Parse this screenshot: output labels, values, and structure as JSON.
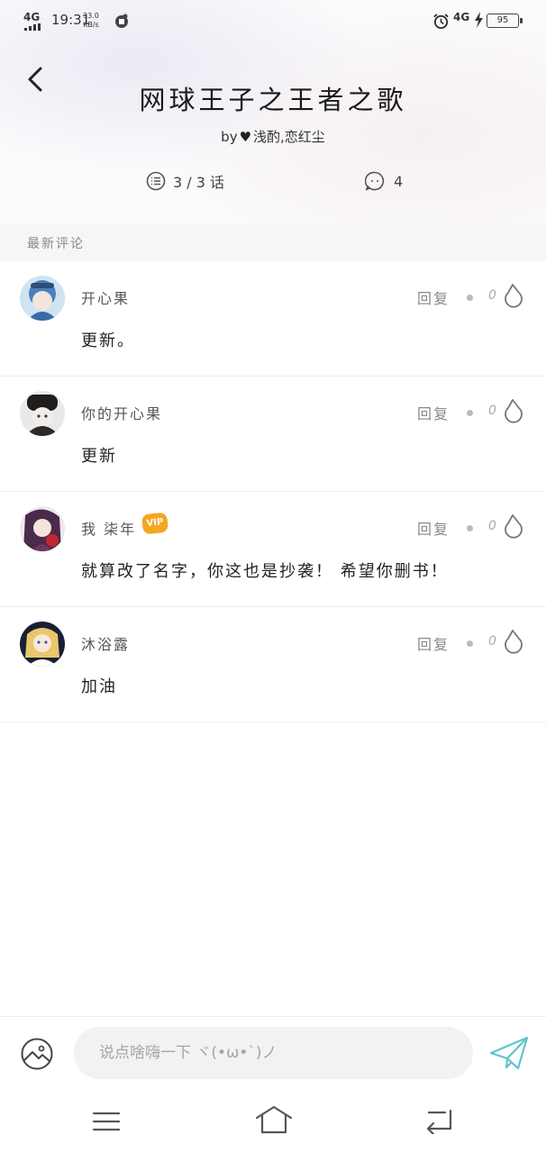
{
  "status_bar": {
    "signal_label": "4G",
    "time": "19:31",
    "speed_value": "33.0",
    "speed_unit": "KB/s",
    "network_label": "4G",
    "battery_level": "95"
  },
  "book": {
    "title": "网球王子之王者之歌",
    "author_prefix": "by",
    "author_name": "浅酌,恋红尘",
    "chapters": "3 / 3 话",
    "comment_count": "4"
  },
  "section": {
    "title": "最新评论"
  },
  "comments": [
    {
      "username": "开心果",
      "vip": false,
      "reply_label": "回复",
      "likes": "0",
      "text": "更新。"
    },
    {
      "username": "你的开心果",
      "vip": false,
      "reply_label": "回复",
      "likes": "0",
      "text": "更新"
    },
    {
      "username": "我 柒年",
      "vip": true,
      "vip_label": "VIP",
      "reply_label": "回复",
      "likes": "0",
      "text": "就算改了名字，你这也是抄袭！ 希望你删书！"
    },
    {
      "username": "沐浴露",
      "vip": false,
      "reply_label": "回复",
      "likes": "0",
      "text": "加油"
    }
  ],
  "input": {
    "placeholder": "说点啥嗨一下 ヾ(•ω•`)ノ"
  },
  "colors": {
    "accent": "#5ec4cc",
    "vip": "#f5a623"
  }
}
